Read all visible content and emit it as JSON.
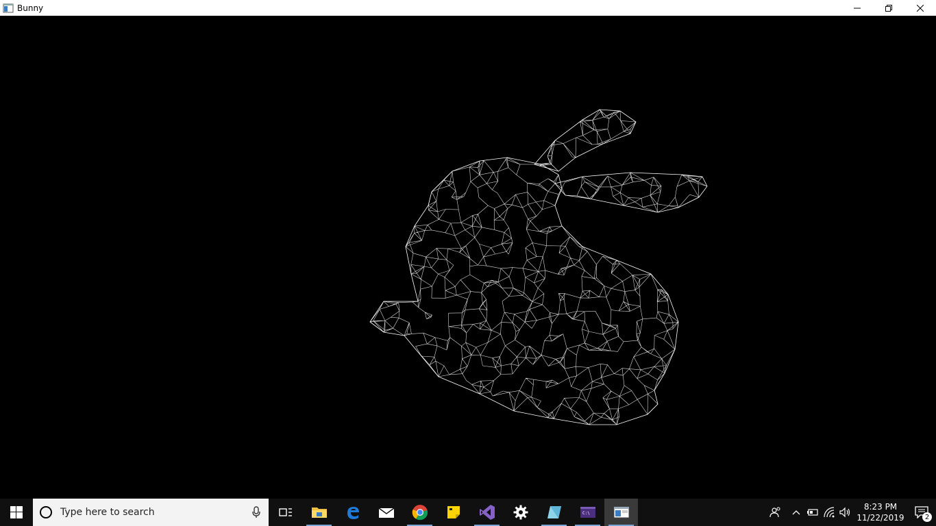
{
  "window": {
    "title": "Bunny"
  },
  "canvas": {
    "background": "#000000",
    "wire_color": "#ffffff",
    "content": "stanford-bunny-wireframe"
  },
  "taskbar": {
    "search_placeholder": "Type here to search",
    "pinned_apps": [
      {
        "name": "task-view",
        "icon": "task-view-icon"
      },
      {
        "name": "file-explorer",
        "icon": "folder-icon"
      },
      {
        "name": "edge",
        "icon": "edge-icon"
      },
      {
        "name": "mail",
        "icon": "mail-icon"
      },
      {
        "name": "chrome",
        "icon": "chrome-icon"
      },
      {
        "name": "sticky-notes",
        "icon": "sticky-notes-icon"
      },
      {
        "name": "visual-studio",
        "icon": "visual-studio-icon"
      },
      {
        "name": "settings",
        "icon": "gear-icon"
      },
      {
        "name": "app",
        "icon": "blue-shape-icon"
      },
      {
        "name": "terminal",
        "icon": "terminal-icon"
      },
      {
        "name": "bunny-window",
        "icon": "window-icon",
        "active": true
      }
    ],
    "clock_time": "8:23 PM",
    "clock_date": "11/22/2019",
    "notification_count": "2"
  }
}
